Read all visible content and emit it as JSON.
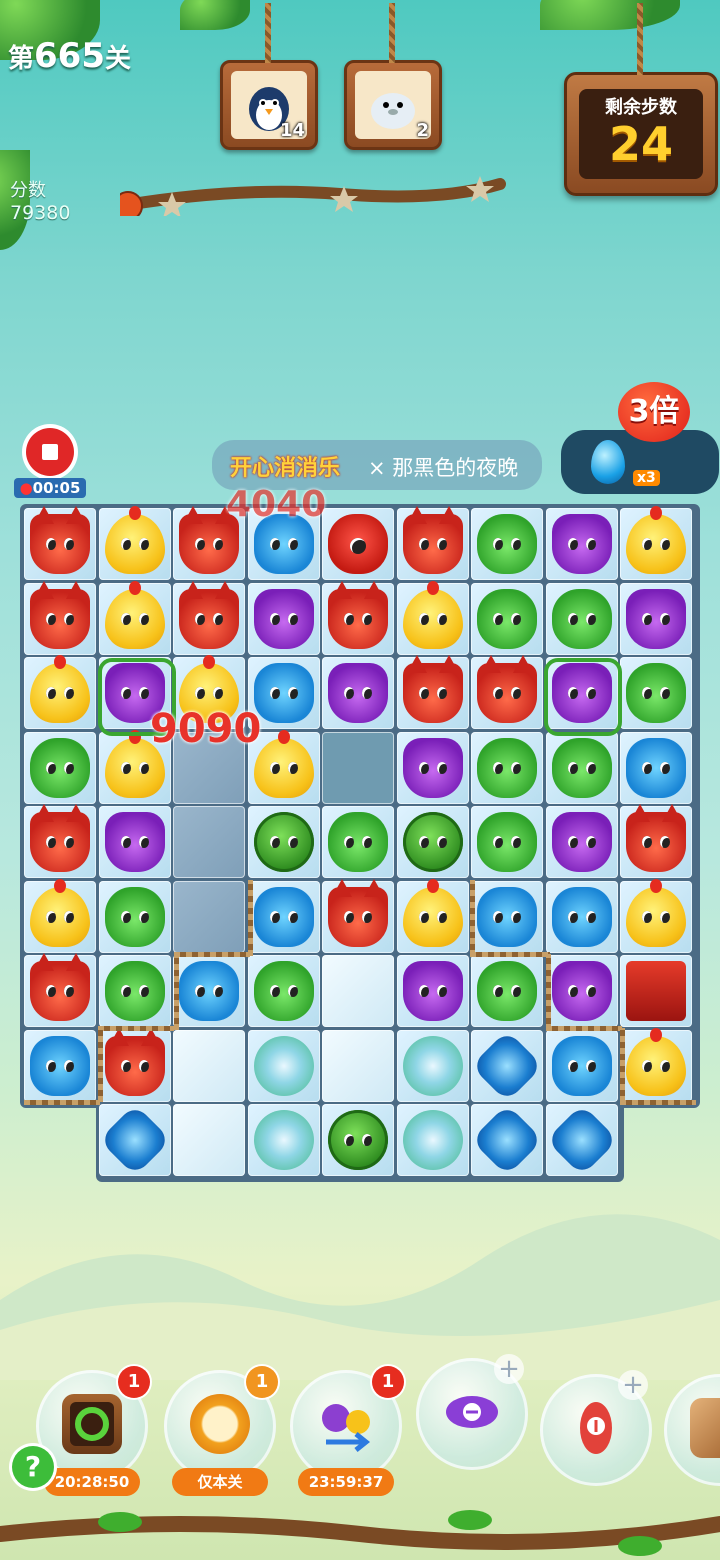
{
  "level": {
    "prefix": "第",
    "number": "665",
    "suffix": "关"
  },
  "score": {
    "label": "分数",
    "value": "79380"
  },
  "goals": [
    {
      "icon": "penguin-icon",
      "count": "14"
    },
    {
      "icon": "seal-icon",
      "count": "2"
    }
  ],
  "moves": {
    "label": "剩余步数",
    "value": "24"
  },
  "timer": {
    "dot": "●",
    "value": "00:05"
  },
  "music": {
    "logo": "开心消消乐",
    "separator": "×",
    "song": "那黑色的夜晚"
  },
  "bonus": {
    "multiplier": "3倍",
    "drop_count": "x3"
  },
  "popups": {
    "score_a": "4040",
    "score_b": "9090"
  },
  "boosters": [
    {
      "name": "refresh",
      "badge": "1",
      "tag": "20:28:50"
    },
    {
      "name": "clock",
      "badge": "1",
      "tag": "仅本关"
    },
    {
      "name": "swap",
      "badge": "1",
      "tag": "23:59:37"
    },
    {
      "name": "h-rocket",
      "badge": "+",
      "tag": ""
    },
    {
      "name": "v-rocket",
      "badge": "+",
      "tag": ""
    },
    {
      "name": "hammer",
      "badge": "",
      "tag": ""
    }
  ],
  "help": {
    "label": "?"
  },
  "colors": {
    "fox": "#c8231b",
    "chick": "#f7c21a",
    "frog": "#2fa32a",
    "owl": "#7a1fb8",
    "bear": "#1a86d6",
    "timer_bg": "#2a6bb0",
    "moves_digits": "#ffcf2e"
  },
  "board": {
    "rows": [
      [
        "fox",
        "chick",
        "fox",
        "bear",
        "monster",
        "fox",
        "frog",
        "owl",
        "chick"
      ],
      [
        "fox",
        "chick",
        "fox",
        "owl",
        "fox",
        "chick",
        "frog",
        "frog",
        "owl"
      ],
      [
        "chick",
        "owl",
        "chick",
        "bear",
        "owl",
        "fox",
        "fox",
        "owl",
        "frog"
      ],
      [
        "frog",
        "chick",
        "crack",
        "chick",
        "empty",
        "owl",
        "frog",
        "frog",
        "bear"
      ],
      [
        "fox",
        "owl",
        "crack",
        "bush",
        "frog",
        "bush",
        "frog",
        "owl",
        "fox"
      ],
      [
        "chick",
        "frog",
        "crack",
        "bear",
        "fox",
        "chick",
        "bear",
        "bear",
        "chick"
      ],
      [
        "fox",
        "frog",
        "bear",
        "frog",
        "ice",
        "owl",
        "frog",
        "owl",
        "redbox"
      ],
      [
        "bear",
        "fox",
        "ice",
        "flower",
        "ice",
        "flower",
        "blueflower",
        "bear",
        "chick"
      ],
      [
        "none",
        "blueflower",
        "ice",
        "flower",
        "bush",
        "flower",
        "blueflower",
        "blueflower",
        "none"
      ]
    ]
  }
}
